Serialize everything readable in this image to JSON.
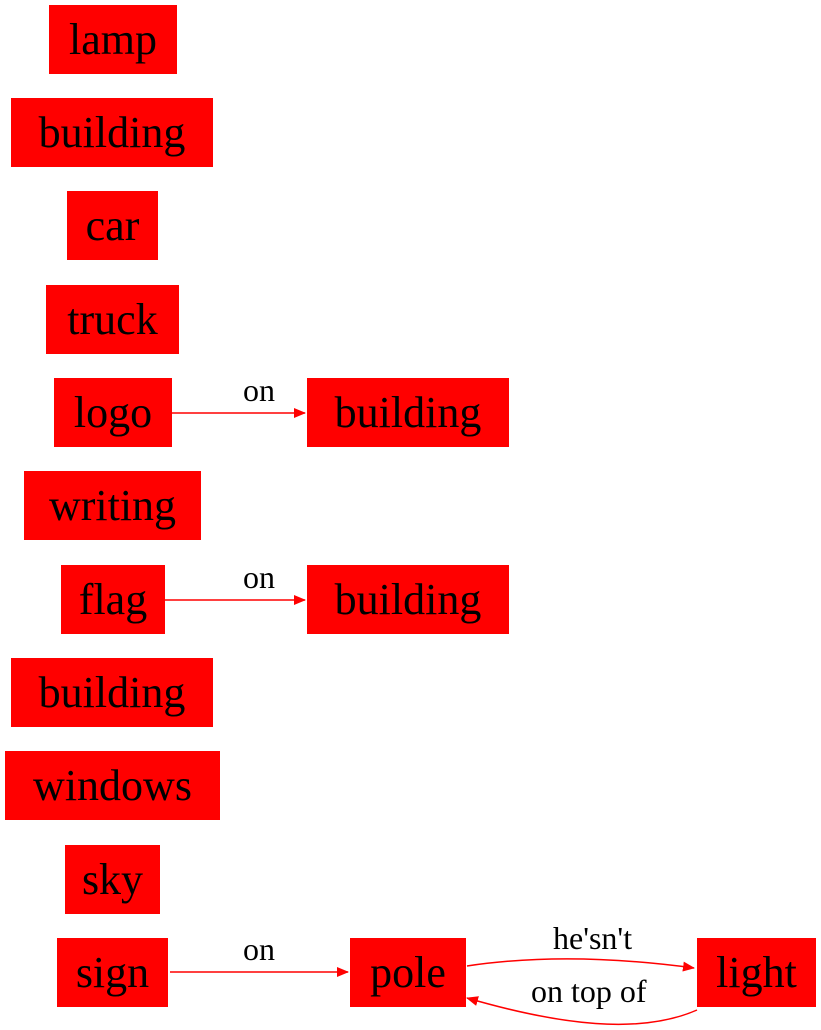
{
  "colors": {
    "node_fill": "#ff0000",
    "edge": "#ff0000",
    "text": "#000000"
  },
  "nodes": {
    "lamp": "lamp",
    "building_1": "building",
    "car": "car",
    "truck": "truck",
    "logo": "logo",
    "building_2": "building",
    "writing": "writing",
    "flag": "flag",
    "building_3": "building",
    "building_4": "building",
    "windows": "windows",
    "sky": "sky",
    "sign": "sign",
    "pole": "pole",
    "light": "light"
  },
  "edges": {
    "logo_building": "on",
    "flag_building": "on",
    "sign_pole": "on",
    "pole_light": "he'sn't",
    "light_pole": "on top of"
  }
}
